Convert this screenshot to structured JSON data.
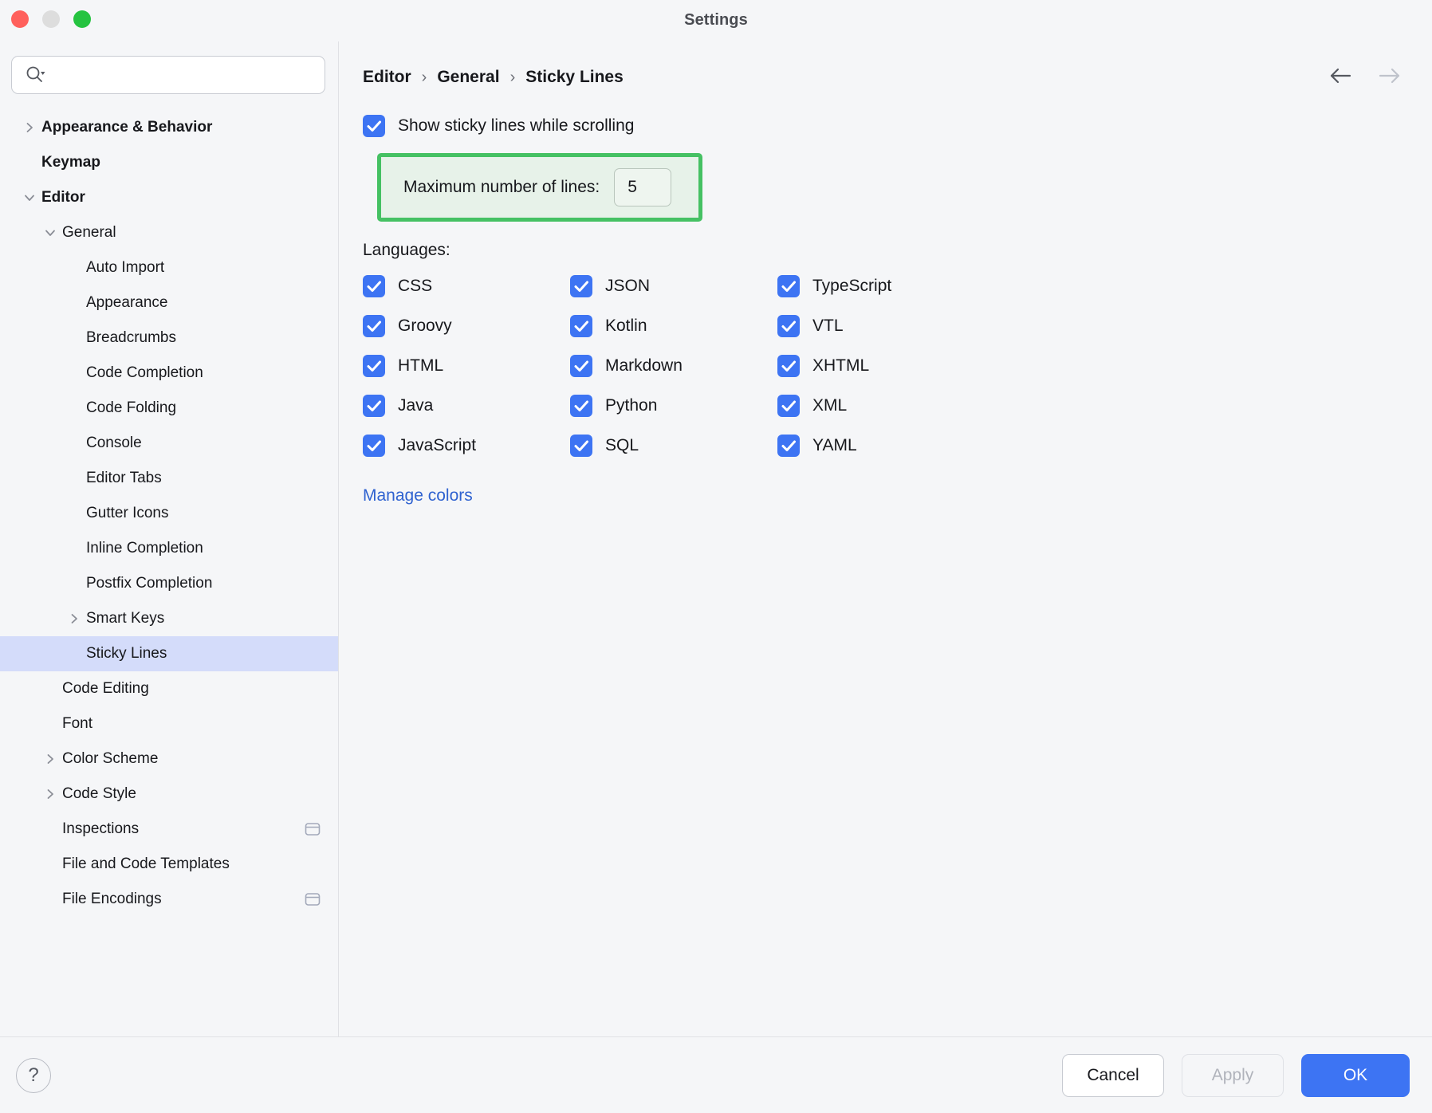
{
  "window": {
    "title": "Settings",
    "traffic_lights": [
      "close-red",
      "minimize-yellow",
      "zoom-green"
    ]
  },
  "search": {
    "value": "",
    "placeholder": "",
    "icon": "search-icon"
  },
  "sidebar": {
    "items": [
      {
        "label": "Appearance & Behavior",
        "level": 0,
        "twisty": "collapsed",
        "bold": true,
        "selected": false,
        "badge": false
      },
      {
        "label": "Keymap",
        "level": 0,
        "twisty": "none",
        "bold": true,
        "selected": false,
        "badge": false
      },
      {
        "label": "Editor",
        "level": 0,
        "twisty": "expanded",
        "bold": true,
        "selected": false,
        "badge": false
      },
      {
        "label": "General",
        "level": 1,
        "twisty": "expanded",
        "bold": false,
        "selected": false,
        "badge": false
      },
      {
        "label": "Auto Import",
        "level": 2,
        "twisty": "none",
        "bold": false,
        "selected": false,
        "badge": false
      },
      {
        "label": "Appearance",
        "level": 2,
        "twisty": "none",
        "bold": false,
        "selected": false,
        "badge": false
      },
      {
        "label": "Breadcrumbs",
        "level": 2,
        "twisty": "none",
        "bold": false,
        "selected": false,
        "badge": false
      },
      {
        "label": "Code Completion",
        "level": 2,
        "twisty": "none",
        "bold": false,
        "selected": false,
        "badge": false
      },
      {
        "label": "Code Folding",
        "level": 2,
        "twisty": "none",
        "bold": false,
        "selected": false,
        "badge": false
      },
      {
        "label": "Console",
        "level": 2,
        "twisty": "none",
        "bold": false,
        "selected": false,
        "badge": false
      },
      {
        "label": "Editor Tabs",
        "level": 2,
        "twisty": "none",
        "bold": false,
        "selected": false,
        "badge": false
      },
      {
        "label": "Gutter Icons",
        "level": 2,
        "twisty": "none",
        "bold": false,
        "selected": false,
        "badge": false
      },
      {
        "label": "Inline Completion",
        "level": 2,
        "twisty": "none",
        "bold": false,
        "selected": false,
        "badge": false
      },
      {
        "label": "Postfix Completion",
        "level": 2,
        "twisty": "none",
        "bold": false,
        "selected": false,
        "badge": false
      },
      {
        "label": "Smart Keys",
        "level": 2,
        "twisty": "collapsed",
        "bold": false,
        "selected": false,
        "badge": false
      },
      {
        "label": "Sticky Lines",
        "level": 2,
        "twisty": "none",
        "bold": false,
        "selected": true,
        "badge": false
      },
      {
        "label": "Code Editing",
        "level": 1,
        "twisty": "none",
        "bold": false,
        "selected": false,
        "badge": false
      },
      {
        "label": "Font",
        "level": 1,
        "twisty": "none",
        "bold": false,
        "selected": false,
        "badge": false
      },
      {
        "label": "Color Scheme",
        "level": 1,
        "twisty": "collapsed",
        "bold": false,
        "selected": false,
        "badge": false
      },
      {
        "label": "Code Style",
        "level": 1,
        "twisty": "collapsed",
        "bold": false,
        "selected": false,
        "badge": false
      },
      {
        "label": "Inspections",
        "level": 1,
        "twisty": "none",
        "bold": false,
        "selected": false,
        "badge": true
      },
      {
        "label": "File and Code Templates",
        "level": 1,
        "twisty": "none",
        "bold": false,
        "selected": false,
        "badge": false
      },
      {
        "label": "File Encodings",
        "level": 1,
        "twisty": "none",
        "bold": false,
        "selected": false,
        "badge": true
      }
    ]
  },
  "breadcrumb": {
    "parts": [
      "Editor",
      "General",
      "Sticky Lines"
    ],
    "separator": "›"
  },
  "nav": {
    "back_icon": "arrow-left-icon",
    "forward_icon": "arrow-right-icon",
    "back_enabled": true,
    "forward_enabled": false
  },
  "settings": {
    "show_sticky_lines": {
      "label": "Show sticky lines while scrolling",
      "checked": true
    },
    "max_lines": {
      "label": "Maximum number of lines:",
      "value": "5",
      "highlighted": true
    },
    "languages_label": "Languages:",
    "languages": [
      {
        "label": "CSS",
        "checked": true
      },
      {
        "label": "JSON",
        "checked": true
      },
      {
        "label": "TypeScript",
        "checked": true
      },
      {
        "label": "Groovy",
        "checked": true
      },
      {
        "label": "Kotlin",
        "checked": true
      },
      {
        "label": "VTL",
        "checked": true
      },
      {
        "label": "HTML",
        "checked": true
      },
      {
        "label": "Markdown",
        "checked": true
      },
      {
        "label": "XHTML",
        "checked": true
      },
      {
        "label": "Java",
        "checked": true
      },
      {
        "label": "Python",
        "checked": true
      },
      {
        "label": "XML",
        "checked": true
      },
      {
        "label": "JavaScript",
        "checked": true
      },
      {
        "label": "SQL",
        "checked": true
      },
      {
        "label": "YAML",
        "checked": true
      }
    ],
    "manage_colors_link": "Manage colors"
  },
  "footer": {
    "help_label": "?",
    "cancel_label": "Cancel",
    "apply_label": "Apply",
    "ok_label": "OK",
    "apply_enabled": false
  },
  "colors": {
    "accent_blue": "#3d74f3",
    "link_blue": "#2f62d0",
    "highlight_green": "#45c163",
    "highlight_bg": "#e7f2e9",
    "selection_blue": "#d4dcfa",
    "window_bg": "#f5f6f8"
  }
}
